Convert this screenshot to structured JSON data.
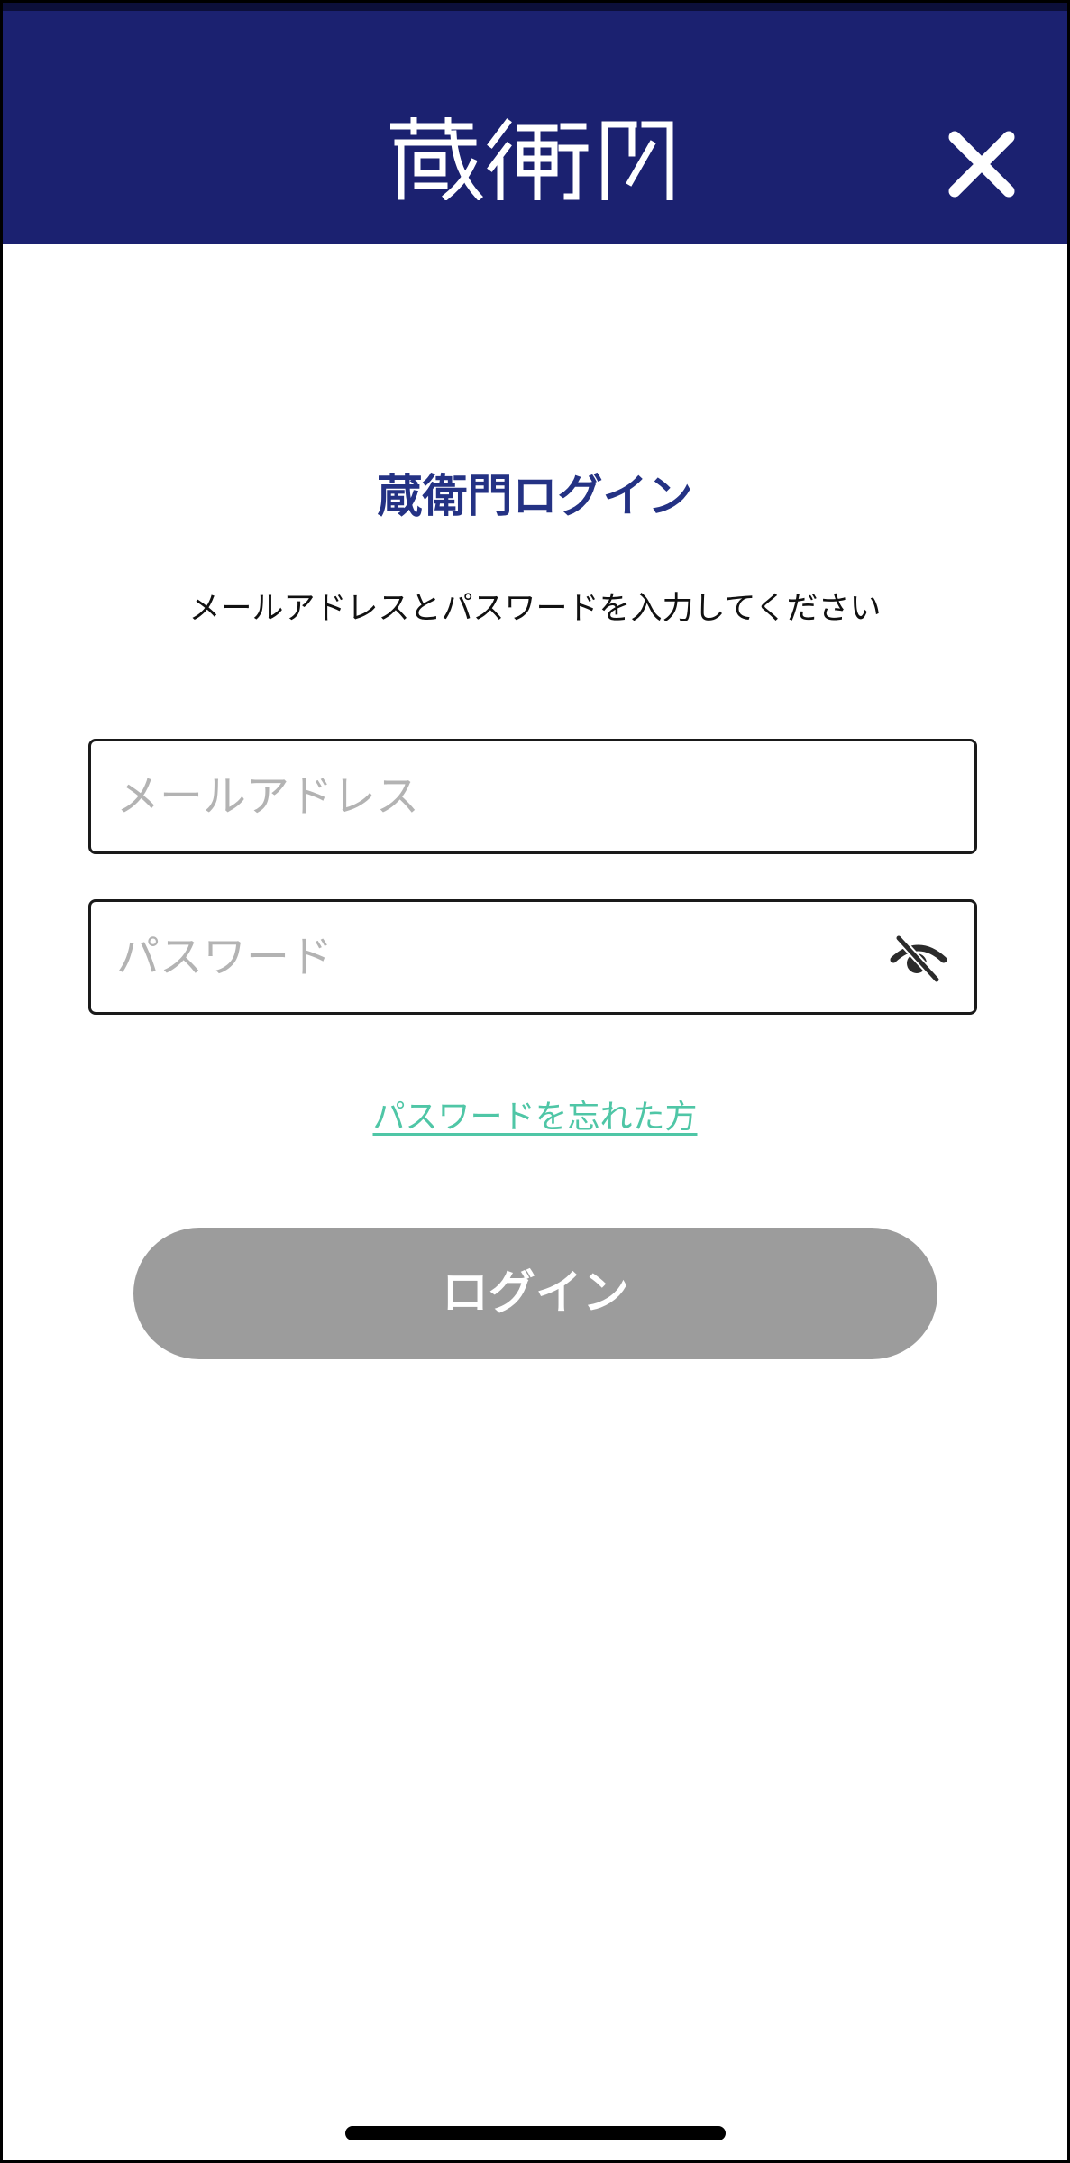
{
  "header": {
    "brand_logo": "蔵衛門",
    "background_color": "#1b2170",
    "close_icon": "close-icon"
  },
  "login": {
    "title": "蔵衛門ログイン",
    "instruction": "メールアドレスとパスワードを入力してください",
    "email": {
      "value": "",
      "placeholder": "メールアドレス"
    },
    "password": {
      "value": "",
      "placeholder": "パスワード",
      "visibility_icon": "eye-off-icon"
    },
    "forgot_password_link": "パスワードを忘れた方",
    "submit_label": "ログイン"
  },
  "colors": {
    "title": "#243284",
    "link": "#4fc6a6",
    "button_disabled": "#9c9c9c"
  }
}
